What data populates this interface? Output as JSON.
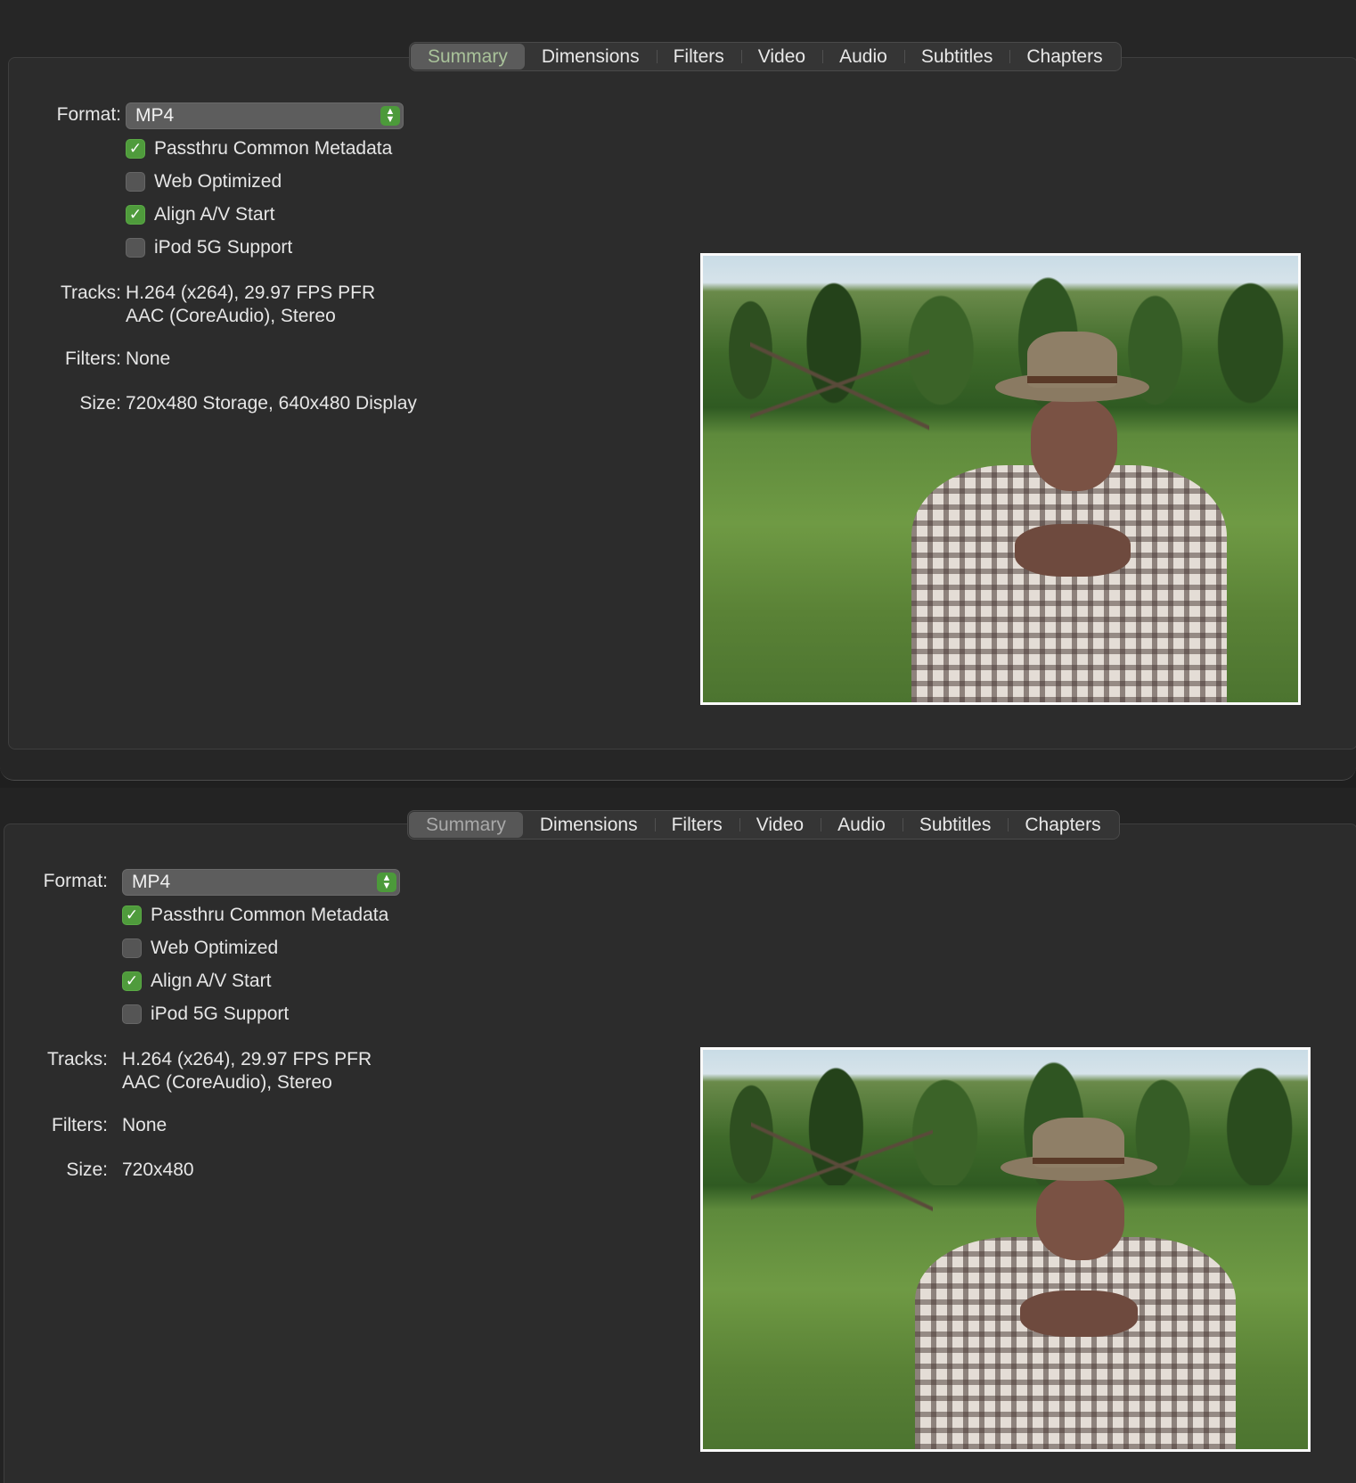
{
  "panels": [
    {
      "tabs": [
        "Summary",
        "Dimensions",
        "Filters",
        "Video",
        "Audio",
        "Subtitles",
        "Chapters"
      ],
      "active_tab": "Summary",
      "format_label": "Format:",
      "format_value": "MP4",
      "options": [
        {
          "label": "Passthru Common Metadata",
          "checked": true
        },
        {
          "label": "Web Optimized",
          "checked": false
        },
        {
          "label": "Align A/V Start",
          "checked": true
        },
        {
          "label": "iPod 5G Support",
          "checked": false
        }
      ],
      "tracks_label": "Tracks:",
      "tracks_line1": "H.264 (x264), 29.97 FPS PFR",
      "tracks_line2": "AAC (CoreAudio), Stereo",
      "filters_label": "Filters:",
      "filters_value": "None",
      "size_label": "Size:",
      "size_value": "720x480 Storage, 640x480 Display"
    },
    {
      "tabs": [
        "Summary",
        "Dimensions",
        "Filters",
        "Video",
        "Audio",
        "Subtitles",
        "Chapters"
      ],
      "active_tab": "Summary",
      "format_label": "Format:",
      "format_value": "MP4",
      "options": [
        {
          "label": "Passthru Common Metadata",
          "checked": true
        },
        {
          "label": "Web Optimized",
          "checked": false
        },
        {
          "label": "Align A/V Start",
          "checked": true
        },
        {
          "label": "iPod 5G Support",
          "checked": false
        }
      ],
      "tracks_label": "Tracks:",
      "tracks_line1": "H.264 (x264), 29.97 FPS PFR",
      "tracks_line2": "AAC (CoreAudio), Stereo",
      "filters_label": "Filters:",
      "filters_value": "None",
      "size_label": "Size:",
      "size_value": "720x480"
    }
  ],
  "colors": {
    "accent_green": "#4f9b3c",
    "active_tab_text": "#a9c29a",
    "background": "#262626"
  },
  "icons": {
    "popup_arrows": "chevron-up-down-icon",
    "checkmark": "checkmark-icon"
  }
}
